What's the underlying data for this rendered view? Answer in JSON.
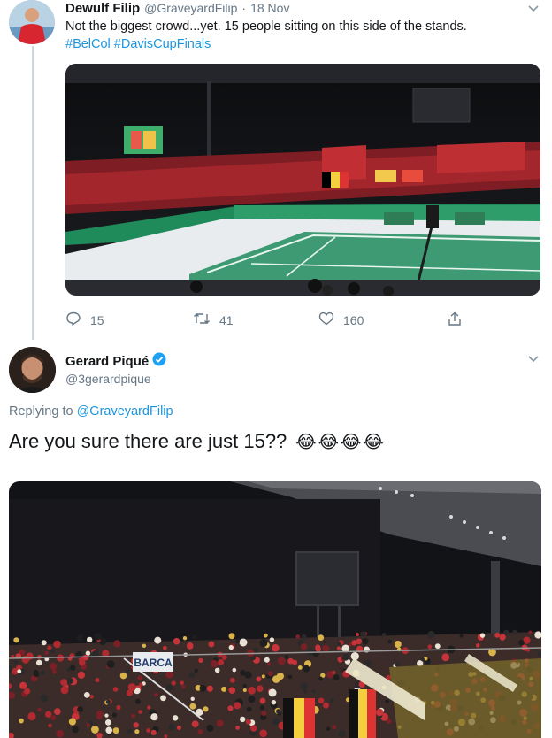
{
  "tweet1": {
    "author_name": "Dewulf Filip",
    "handle": "@GraveyardFilip",
    "separator": "·",
    "date": "18 Nov",
    "text": "Not the biggest crowd...yet. 15 people sitting on this side of the stands.",
    "hashtags": "#BelCol #DavisCupFinals",
    "replies": "15",
    "retweets": "41",
    "likes": "160"
  },
  "tweet2": {
    "author_name": "Gerard Piqué",
    "handle": "@3gerardpique",
    "replying_prefix": "Replying to ",
    "replying_to": "@GraveyardFilip",
    "text": "Are you sure there are just 15??",
    "emojis": "😂😂😂😂",
    "sign_text": "BARCA"
  },
  "colors": {
    "link": "#1b95e0",
    "verified": "#1da1f2",
    "court_green": "#3d9a72",
    "seat_red": "#b02a30"
  },
  "icons": [
    "reply-icon",
    "retweet-icon",
    "like-icon",
    "share-icon",
    "chevron-down-icon",
    "verified-badge-icon"
  ]
}
